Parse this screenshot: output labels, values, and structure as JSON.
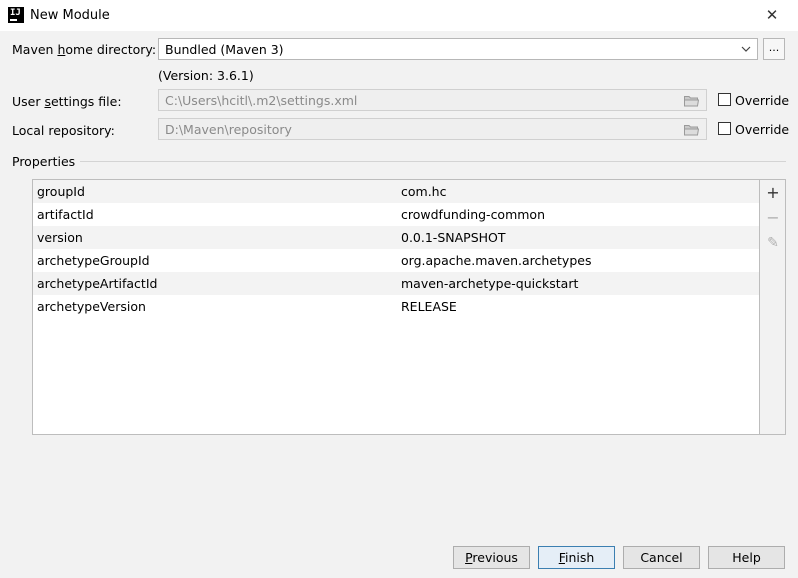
{
  "window": {
    "title": "New Module",
    "app_icon_text": "IJ"
  },
  "maven_home": {
    "label_pre": "Maven ",
    "label_mnemonic": "h",
    "label_post": "ome directory:",
    "value": "Bundled (Maven 3)",
    "version": "(Version: 3.6.1)",
    "browse_label": "..."
  },
  "user_settings": {
    "label_pre": "User ",
    "label_mnemonic": "s",
    "label_post": "ettings file:",
    "value": "C:\\Users\\hcitl\\.m2\\settings.xml",
    "override_label": "Override",
    "override_checked": false
  },
  "local_repo": {
    "label": "Local repository:",
    "value": "D:\\Maven\\repository",
    "override_label": "Override",
    "override_checked": false
  },
  "properties": {
    "label": "Properties",
    "rows": [
      {
        "key": "groupId",
        "value": "com.hc"
      },
      {
        "key": "artifactId",
        "value": "crowdfunding-common"
      },
      {
        "key": "version",
        "value": "0.0.1-SNAPSHOT"
      },
      {
        "key": "archetypeGroupId",
        "value": "org.apache.maven.archetypes"
      },
      {
        "key": "archetypeArtifactId",
        "value": "maven-archetype-quickstart"
      },
      {
        "key": "archetypeVersion",
        "value": "RELEASE"
      }
    ],
    "tools": {
      "add": "+",
      "remove": "−",
      "edit": "✎"
    }
  },
  "buttons": {
    "previous_mnemonic": "P",
    "previous_rest": "revious",
    "finish_mnemonic": "F",
    "finish_rest": "inish",
    "cancel": "Cancel",
    "help": "Help"
  },
  "colors": {
    "accent": "#3c7fb1",
    "background": "#f2f2f2"
  }
}
